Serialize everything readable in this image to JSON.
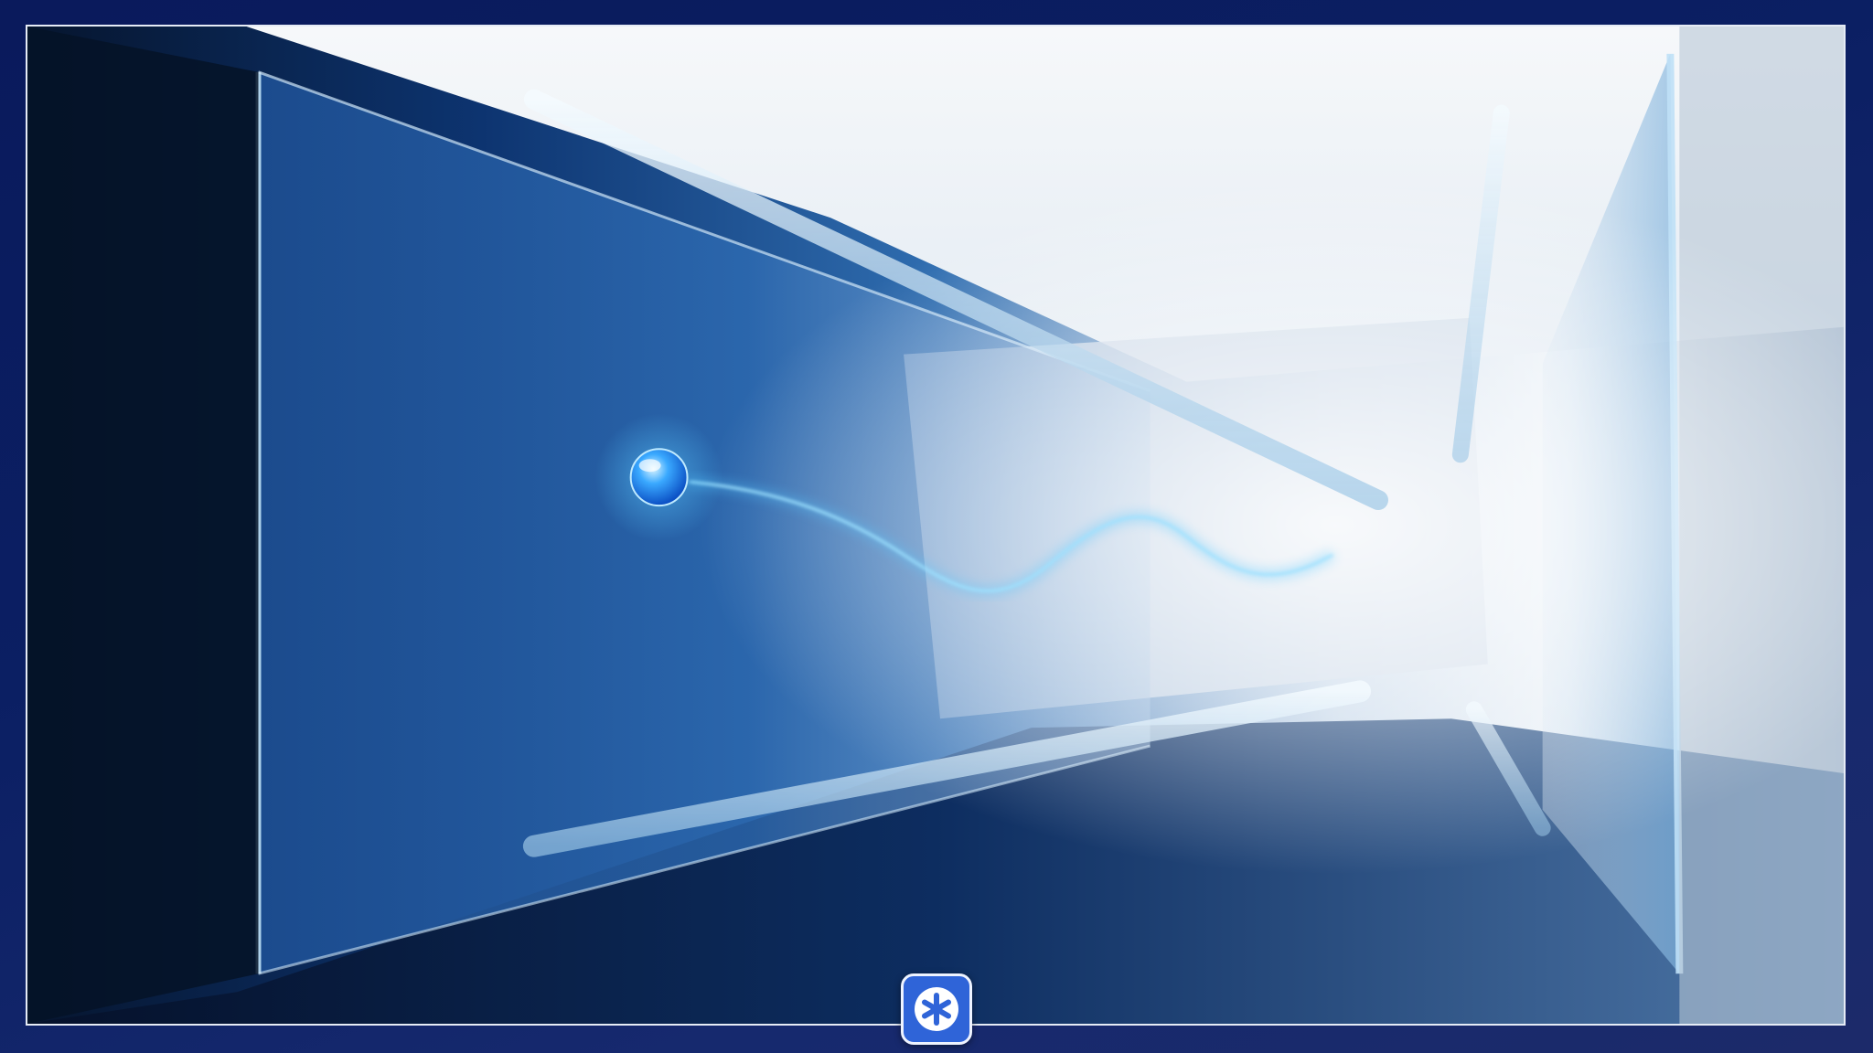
{
  "wallpaper": {
    "description_icon": "glass-corridor-wallpaper"
  },
  "taskbar": {
    "launcher": {
      "icon": "asterisk-icon",
      "accent_color": "#2f64d8",
      "border_color": "#eef3ff"
    }
  },
  "colors": {
    "frame_bg": "#0b1f63",
    "frame_border": "#e6ecf6",
    "glow": "#58c8ff"
  }
}
